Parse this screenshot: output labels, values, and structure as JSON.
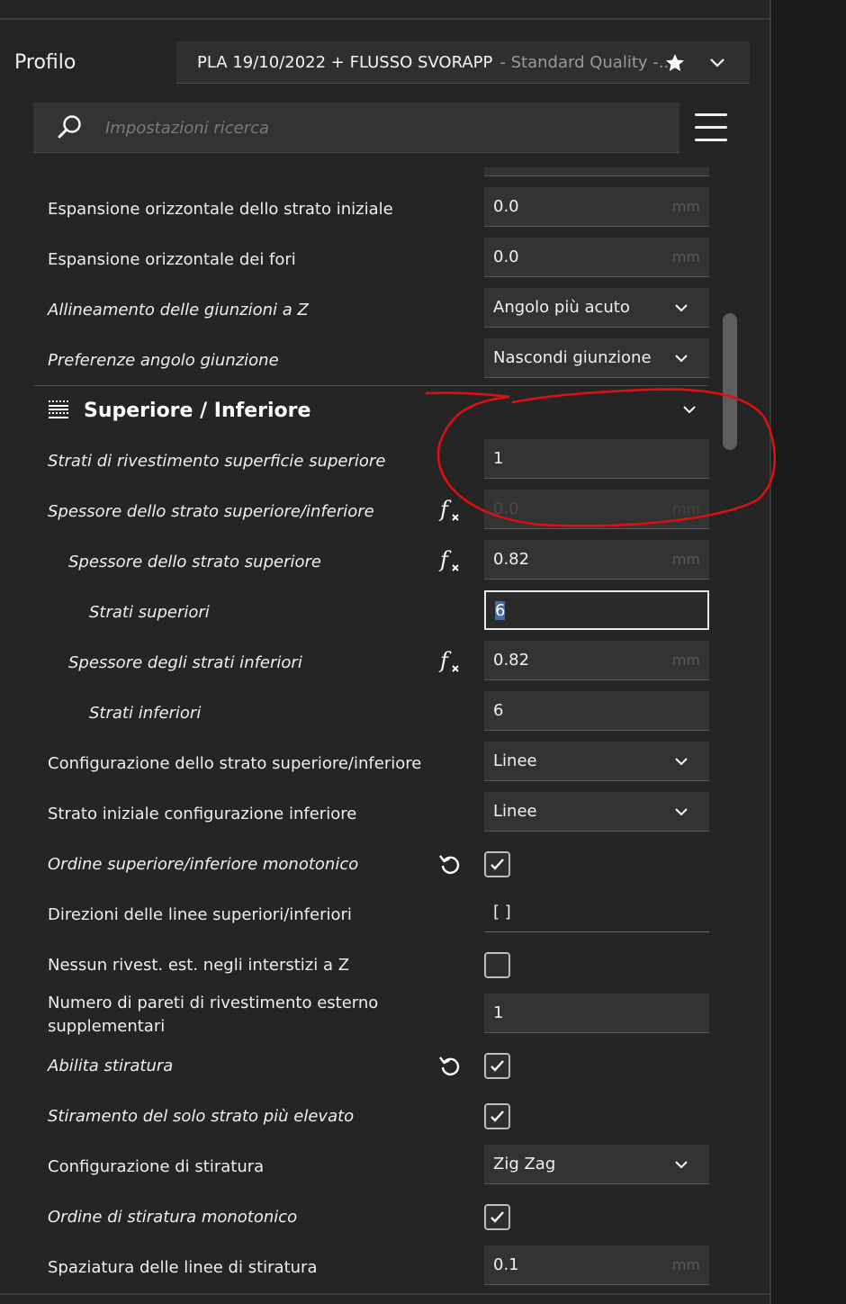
{
  "profile": {
    "label": "Profilo",
    "selected_main": "PLA 19/10/2022 + FLUSSO SVORAPP",
    "selected_sub": "- Standard Quality -..."
  },
  "search": {
    "placeholder": "Impostazioni ricerca",
    "value": ""
  },
  "section": {
    "title": "Superiore / Inferiore"
  },
  "settings": [
    {
      "label": "Espansione orizzontale dello strato iniziale",
      "value": "0.0",
      "unit": "mm"
    },
    {
      "label": "Espansione orizzontale dei fori",
      "value": "0.0",
      "unit": "mm"
    },
    {
      "label": "Allineamento delle giunzioni a Z",
      "value": "Angolo più acuto"
    },
    {
      "label": "Preferenze angolo giunzione",
      "value": "Nascondi giunzione"
    },
    {
      "label": "Strati di rivestimento superficie superiore",
      "value": "1"
    },
    {
      "label": "Spessore dello strato superiore/inferiore",
      "value": "0.0",
      "unit": "mm"
    },
    {
      "label": "Spessore dello strato superiore",
      "value": "0.82",
      "unit": "mm"
    },
    {
      "label": "Strati superiori",
      "value": "6"
    },
    {
      "label": "Spessore degli strati inferiori",
      "value": "0.82",
      "unit": "mm"
    },
    {
      "label": "Strati inferiori",
      "value": "6"
    },
    {
      "label": "Configurazione dello strato superiore/inferiore",
      "value": "Linee"
    },
    {
      "label": "Strato iniziale configurazione inferiore",
      "value": "Linee"
    },
    {
      "label": "Ordine superiore/inferiore monotonico",
      "checked": true
    },
    {
      "label": "Direzioni delle linee superiori/inferiori",
      "value": "[ ]"
    },
    {
      "label": "Nessun rivest. est. negli interstizi a Z",
      "checked": false
    },
    {
      "label": "Numero di pareti di rivestimento esterno supplementari",
      "value": "1"
    },
    {
      "label": "Abilita stiratura",
      "checked": true
    },
    {
      "label": "Stiramento del solo strato più elevato",
      "checked": true
    },
    {
      "label": "Configurazione di stiratura",
      "value": "Zig Zag"
    },
    {
      "label": "Ordine di stiratura monotonico",
      "checked": true
    },
    {
      "label": "Spaziatura delle linee di stiratura",
      "value": "0.1",
      "unit": "mm"
    }
  ],
  "colors": {
    "panel_bg": "#252525",
    "field_bg": "#333333",
    "text": "#efefef",
    "annotation": "#e01010",
    "scrollbar": "#5e5e5e"
  }
}
